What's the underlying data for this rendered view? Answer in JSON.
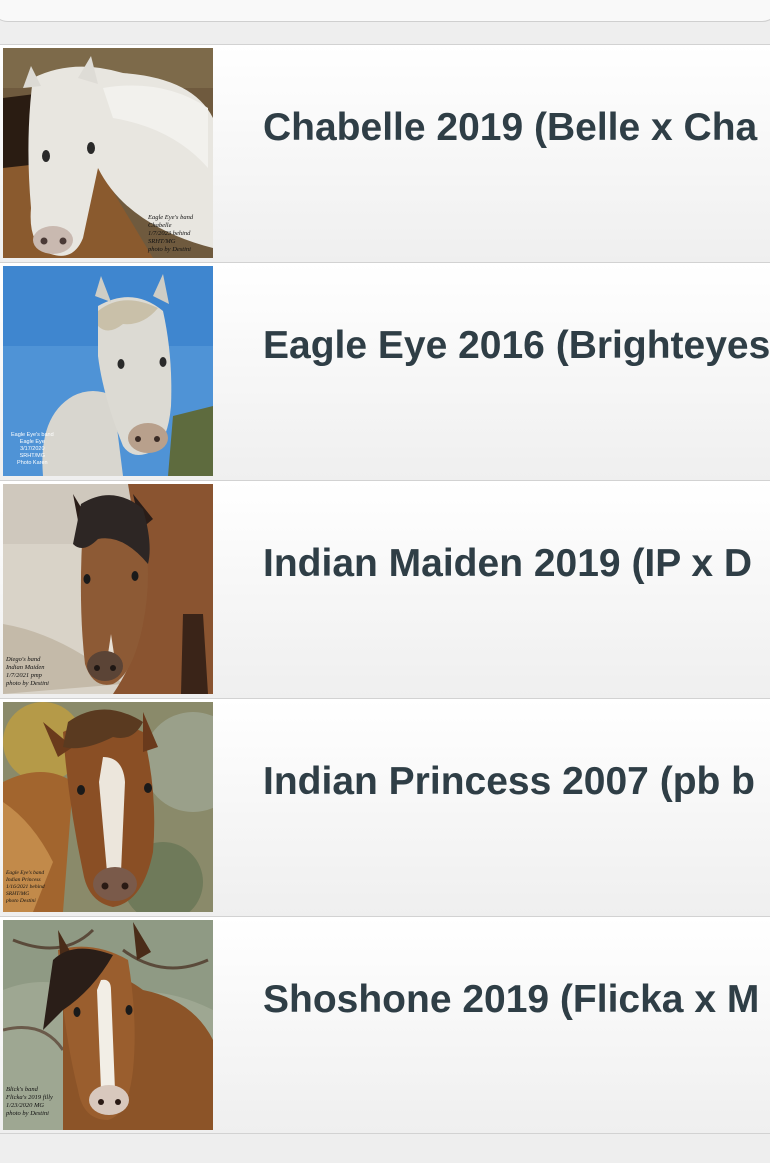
{
  "search": {
    "placeholder": ""
  },
  "items": [
    {
      "title": "Chabelle 2019 (Belle x Cha",
      "photo_caption": "Eagle Eye's band\nChabelle\n1/7/2023 behind\nSRHT/MG\nphoto by Destini",
      "photo_subject": "grey-horse-with-bay-horse"
    },
    {
      "title": "Eagle Eye 2016 (Brighteyes",
      "photo_caption": "Eagle Eye's band\nEagle Eye\n3/17/2020\nSRHT/MG\nPhoto Karen",
      "photo_subject": "flea-bitten-grey-horse-blue-sky"
    },
    {
      "title": "Indian Maiden 2019 (IP x D",
      "photo_caption": "Diego's band\nIndian Maiden\n1/7/2021 pmp\nphoto by Destini",
      "photo_subject": "bay-horse-sandy-ground"
    },
    {
      "title": "Indian Princess 2007 (pb b",
      "photo_caption": "Eagle Eye's band\nIndian Princess\n1/16/2021 behind\nSRHT/MG\nphoto Destini",
      "photo_subject": "chestnut-horse-with-blaze"
    },
    {
      "title": "Shoshone 2019 (Flicka x M",
      "photo_caption": "Blick's band\nFlicka's 2019 filly\n1/23/2020 MG\nphoto by Destini",
      "photo_subject": "bay-horse-with-blaze-trees"
    }
  ]
}
